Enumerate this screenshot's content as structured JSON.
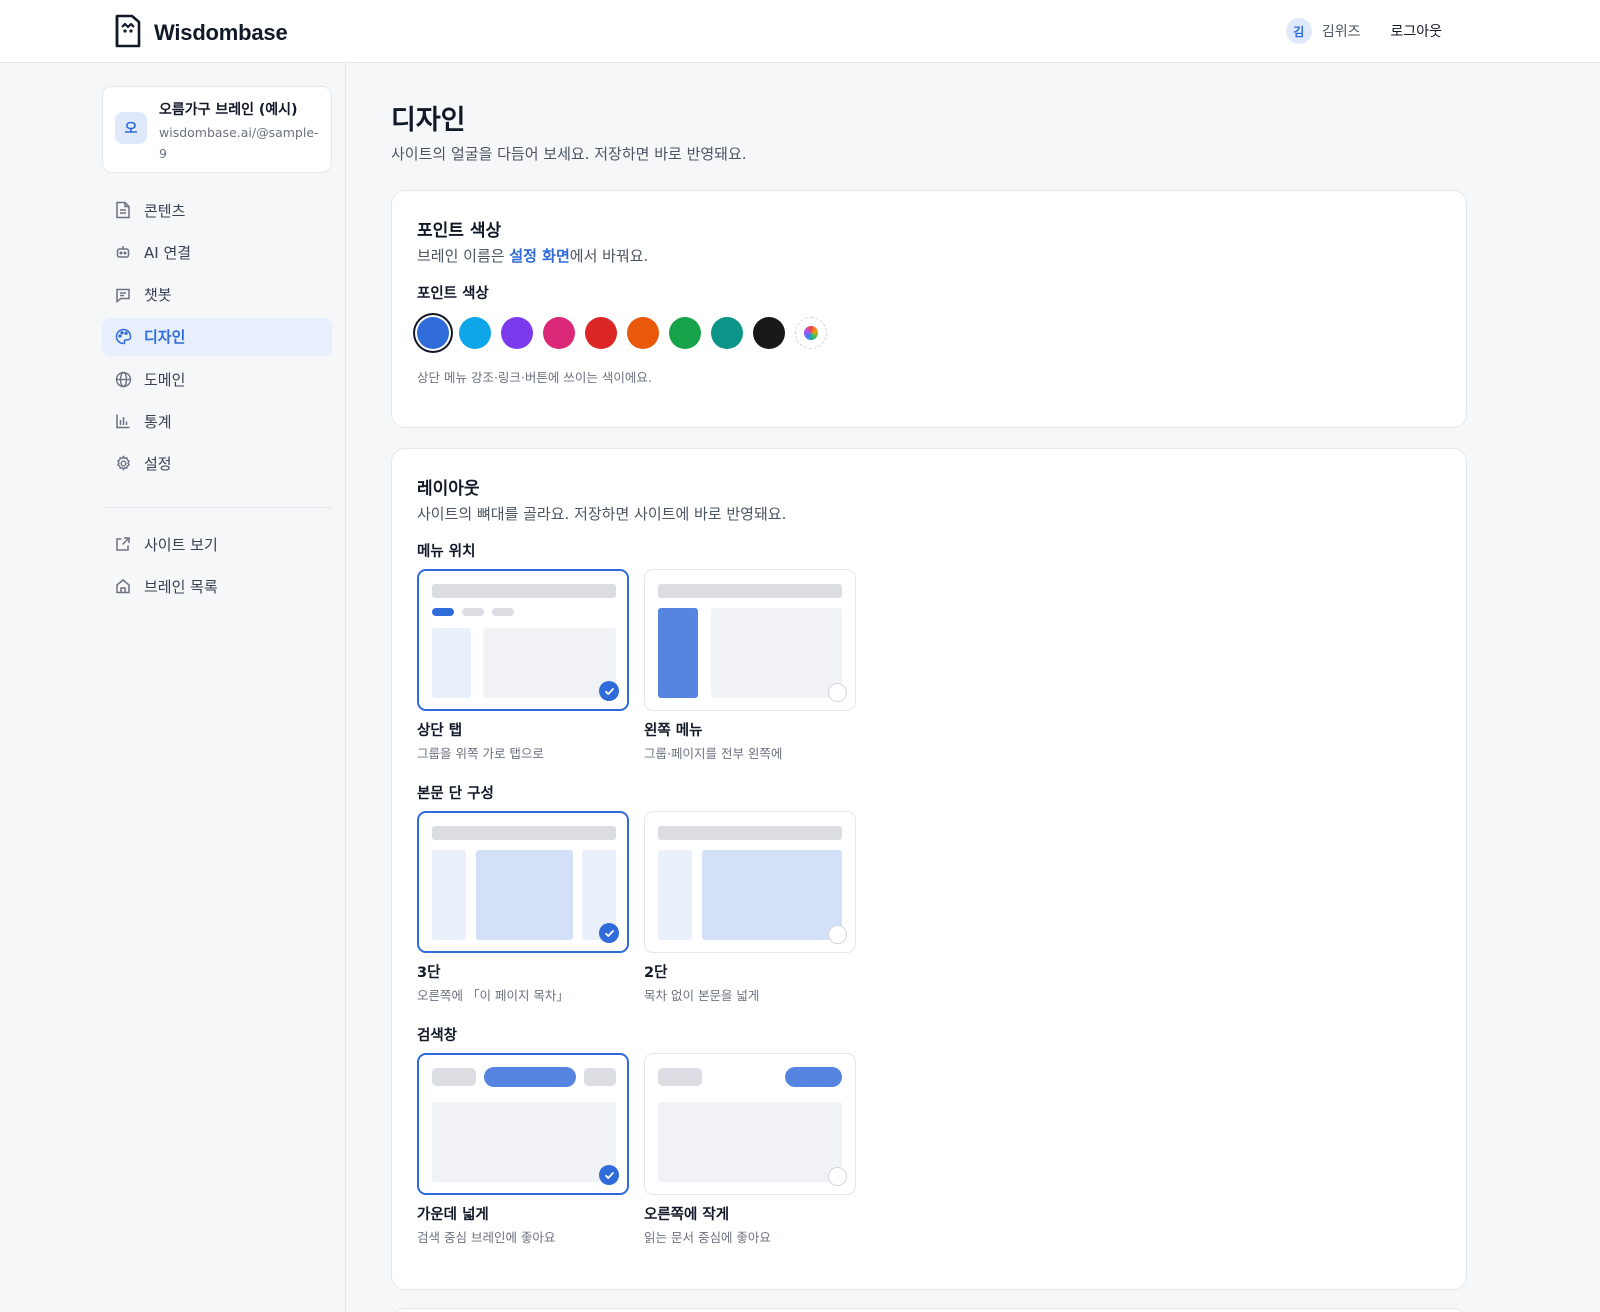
{
  "header": {
    "brand": "Wisdombase",
    "user_initial": "김",
    "user_name": "김위즈",
    "logout": "로그아웃"
  },
  "site": {
    "initial": "오",
    "title": "오름가구 브레인 (예시)",
    "url": "wisdombase.ai/@sample-9"
  },
  "nav": {
    "items": [
      {
        "label": "콘텐츠",
        "icon": "document-icon"
      },
      {
        "label": "AI 연결",
        "icon": "robot-icon"
      },
      {
        "label": "챗봇",
        "icon": "chat-icon"
      },
      {
        "label": "디자인",
        "icon": "palette-icon",
        "active": true
      },
      {
        "label": "도메인",
        "icon": "globe-icon"
      },
      {
        "label": "통계",
        "icon": "bar-chart-icon"
      },
      {
        "label": "설정",
        "icon": "gear-icon"
      }
    ],
    "secondary": [
      {
        "label": "사이트 보기",
        "icon": "external-link-icon"
      },
      {
        "label": "브레인 목록",
        "icon": "home-icon"
      }
    ]
  },
  "page": {
    "title": "디자인",
    "subtitle": "사이트의 얼굴을 다듬어 보세요. 저장하면 바로 반영돼요."
  },
  "accent": {
    "title": "포인트 색상",
    "desc_prefix": "브레인 이름은 ",
    "desc_link": "설정 화면",
    "desc_suffix": "에서 바꿔요.",
    "label": "포인트 색상",
    "colors": [
      "#2f6bd9",
      "#0ea5e9",
      "#7c3aed",
      "#db2777",
      "#dc2626",
      "#ea580c",
      "#16a34a",
      "#0d9488",
      "#18181b"
    ],
    "selected_color": "#2f6bd9",
    "hint": "상단 메뉴 강조·링크·버튼에 쓰이는 색이에요."
  },
  "layout": {
    "title": "레이아웃",
    "desc": "사이트의 뼈대를 골라요. 저장하면 사이트에 바로 반영돼요.",
    "menu": {
      "label": "메뉴 위치",
      "options": [
        {
          "title": "상단 탭",
          "sub": "그룹을 위쪽 가로 탭으로",
          "selected": true
        },
        {
          "title": "왼쪽 메뉴",
          "sub": "그룹·페이지를 전부 왼쪽에",
          "selected": false
        }
      ]
    },
    "columns": {
      "label": "본문 단 구성",
      "options": [
        {
          "title": "3단",
          "sub": "오른쪽에 「이 페이지 목차」",
          "selected": true
        },
        {
          "title": "2단",
          "sub": "목차 없이 본문을 넓게",
          "selected": false
        }
      ]
    },
    "search": {
      "label": "검색창",
      "options": [
        {
          "title": "가운데 넓게",
          "sub": "검색 중심 브레인에 좋아요",
          "selected": true
        },
        {
          "title": "오른쪽에 작게",
          "sub": "읽는 문서 중심에 좋아요",
          "selected": false
        }
      ]
    }
  }
}
